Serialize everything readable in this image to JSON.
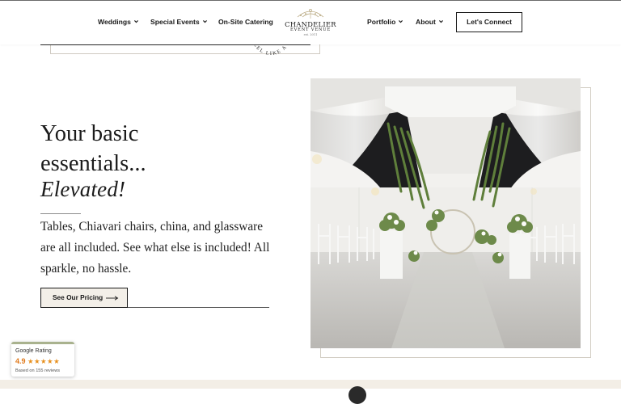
{
  "nav": {
    "items_left": [
      "Weddings",
      "Special Events",
      "On-Site Catering"
    ],
    "items_right": [
      "Portfolio",
      "About"
    ],
    "cta": "Let's Connect"
  },
  "logo": {
    "name": "CHANDELIER",
    "sub": "EVENT VENUE",
    "tag": "est. 2011"
  },
  "stamp_text": "FEEL LIKE A DIAM",
  "hero": {
    "headline_line1": "Your basic",
    "headline_line2": "essentials...",
    "script": "Elevated!",
    "body": "Tables, Chiavari chairs, china, and glassware are all included. See what else is included! All sparkle, no hassle.",
    "button": "See Our Pricing"
  },
  "rating": {
    "title": "Google Rating",
    "score": "4.9",
    "stars": "★★★★★",
    "reviews": "Based on 155 reviews"
  },
  "colors": {
    "accent_cream": "#f3efe8",
    "star_orange": "#e7901e",
    "rating_border": "#a9b28e"
  }
}
